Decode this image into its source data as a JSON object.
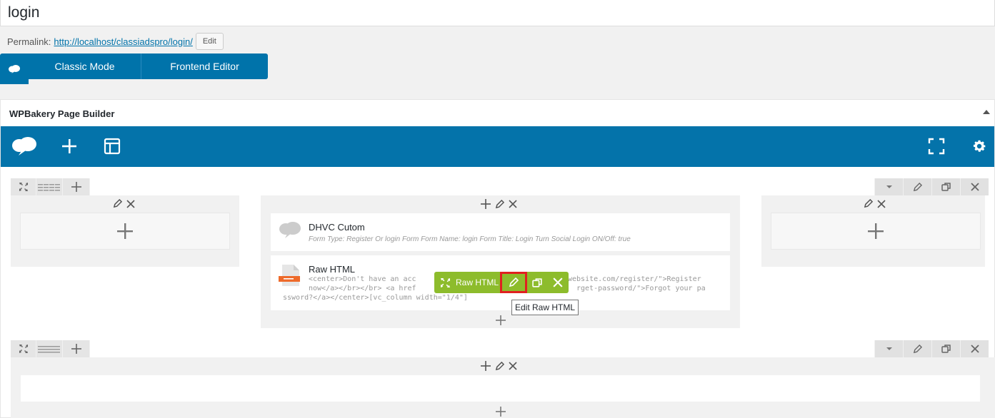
{
  "title": {
    "value": "login"
  },
  "permalink": {
    "label": "Permalink:",
    "url_prefix": "http://localhost/classiadspro/",
    "url_slug": "login",
    "url_suffix": "/",
    "edit_label": "Edit"
  },
  "modes": {
    "classic_label": "Classic Mode",
    "frontend_label": "Frontend Editor"
  },
  "panel": {
    "title": "WPBakery Page Builder"
  },
  "colors": {
    "wpb_blue": "#0473aa",
    "green": "#8dbc2c",
    "highlight_red": "#e02020"
  },
  "elements": {
    "dhvc": {
      "title": "DHVC Cutom",
      "desc": "Form Type: Register Or login Form  Form Name: login  Form Title: Login  Turn Social Login ON/Off: true"
    },
    "raw_html": {
      "title": "Raw HTML",
      "code_line1_a": "<center>Don't have an acc",
      "code_line1_b": "website.com/register/\">Register",
      "code_line2_a": "now</a></br></br> <a href",
      "code_line2_b": "rget-password/\">Forgot your pa",
      "code_line3": "ssword?</a></center>[vc_column width=\"1/4\"]",
      "hover_label": "Raw HTML",
      "tooltip": "Edit Raw HTML"
    }
  }
}
